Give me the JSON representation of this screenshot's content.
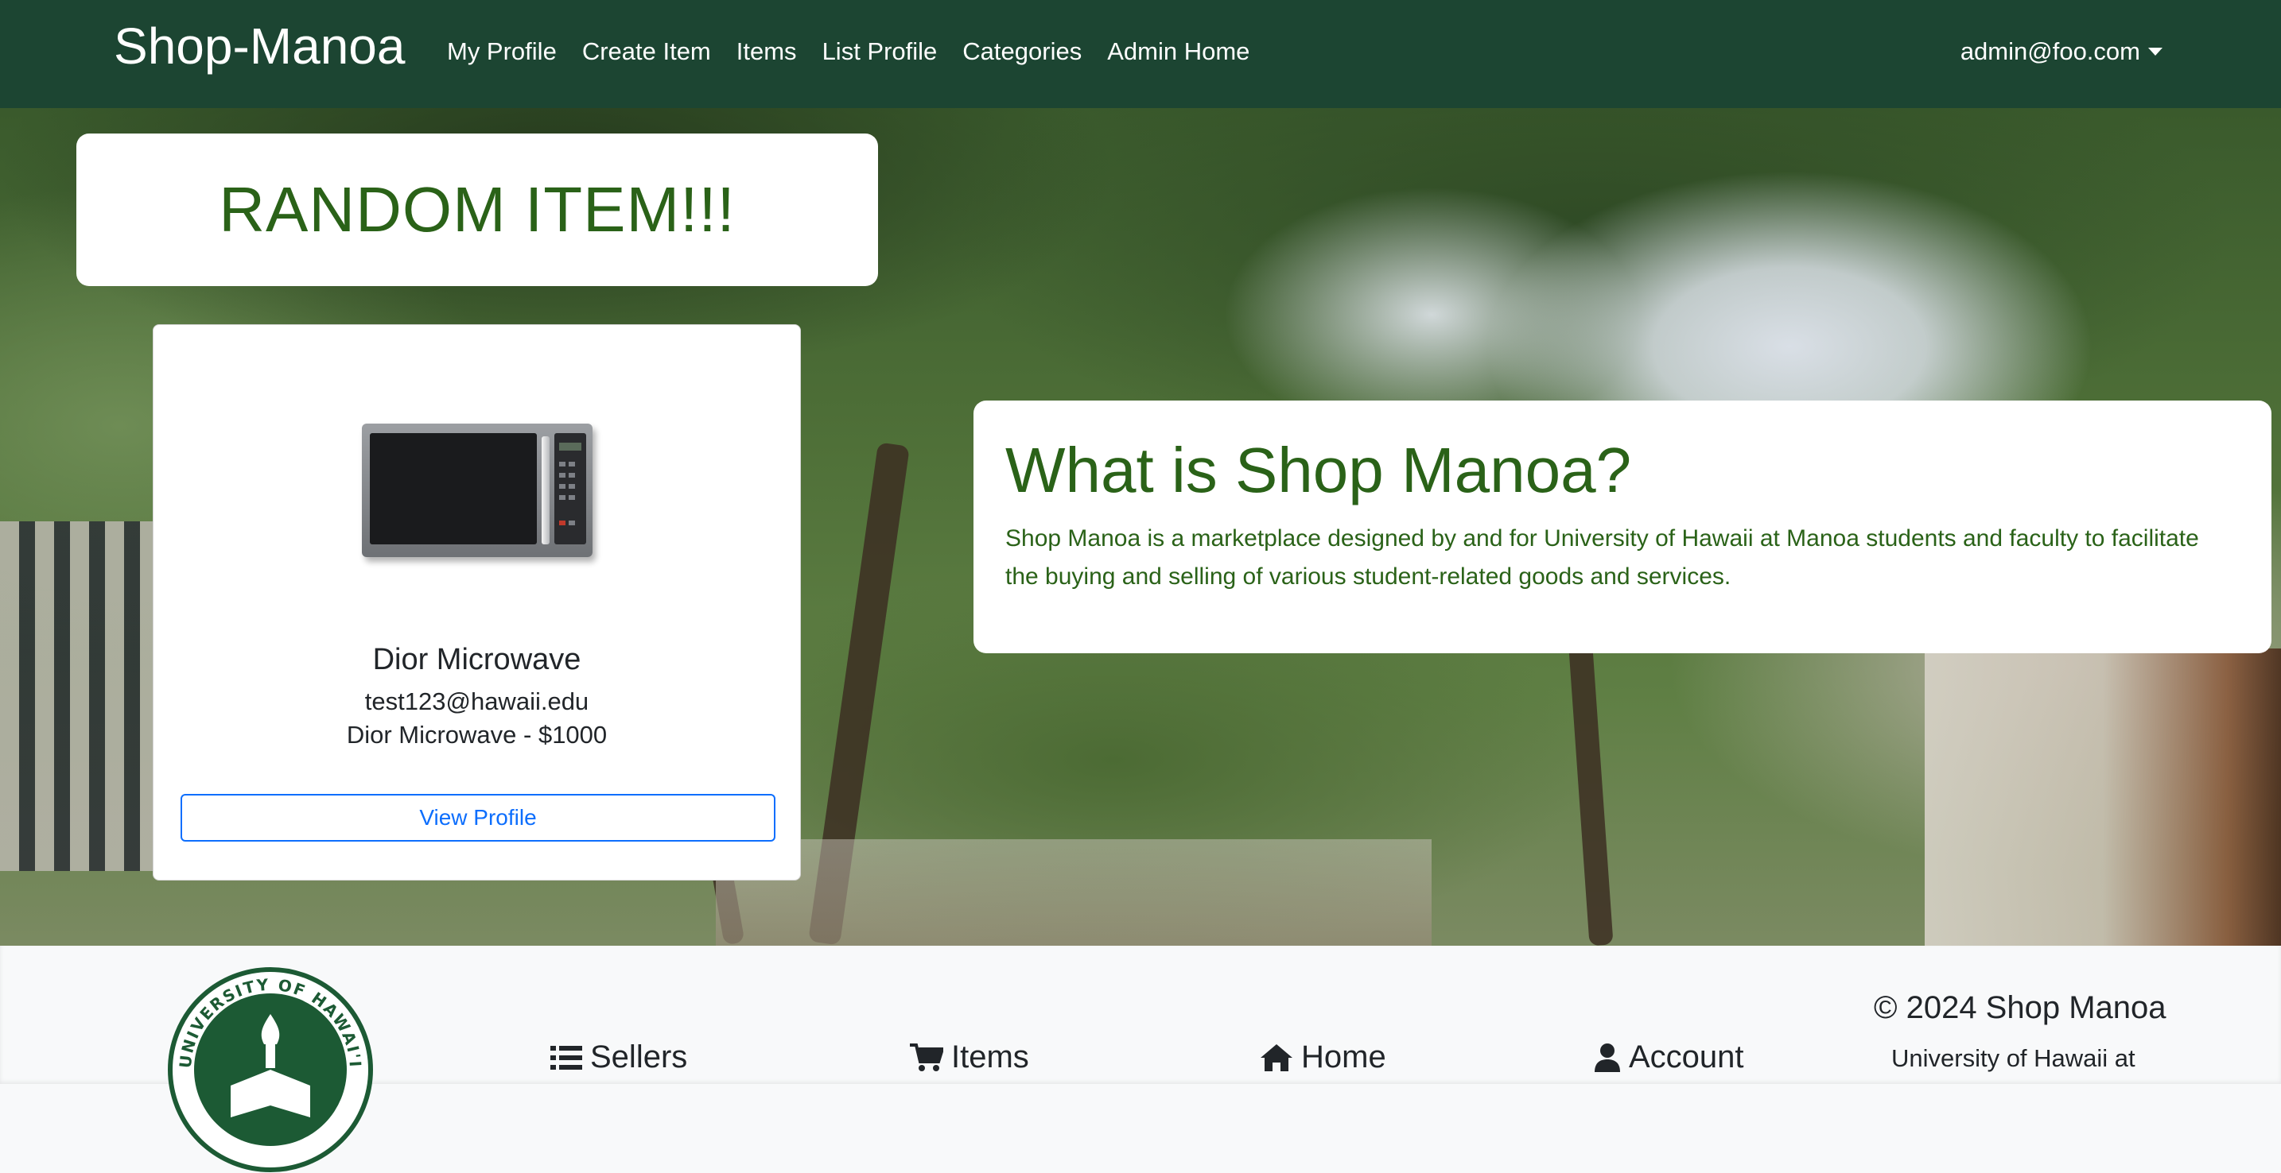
{
  "navbar": {
    "brand": "Shop-Manoa",
    "links": [
      "My Profile",
      "Create Item",
      "Items",
      "List Profile",
      "Categories",
      "Admin Home"
    ],
    "user": "admin@foo.com"
  },
  "hero": {
    "random_title": "RANDOM ITEM!!!",
    "item": {
      "name": "Dior Microwave",
      "email": "test123@hawaii.edu",
      "description": "Dior Microwave - $1000",
      "button": "View Profile"
    },
    "about": {
      "title": "What is Shop Manoa?",
      "body": "Shop Manoa is a marketplace designed by and for University of Hawaii at Manoa students and faculty to facilitate the buying and selling of various student-related goods and services."
    }
  },
  "footer": {
    "seal_text": "UNIVERSITY OF HAWAI'I",
    "links": [
      {
        "label": "Sellers",
        "icon": "list-icon"
      },
      {
        "label": "Items",
        "icon": "cart-icon"
      },
      {
        "label": "Home",
        "icon": "home-icon"
      },
      {
        "label": "Account",
        "icon": "user-icon"
      }
    ],
    "copyright": "© 2024 Shop Manoa",
    "university": "University of Hawaii at"
  },
  "colors": {
    "navbar": "#1c4532",
    "accent_green": "#2a6218",
    "button_blue": "#0d6efd"
  }
}
